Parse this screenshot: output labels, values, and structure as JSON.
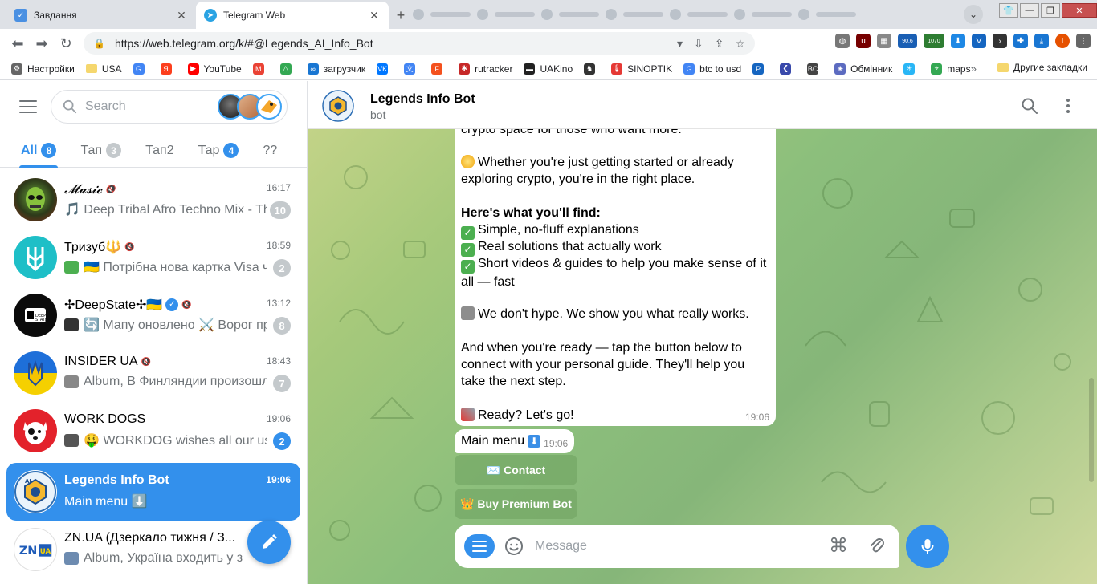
{
  "browser": {
    "tabs": [
      {
        "title": "Завдання"
      },
      {
        "title": "Telegram Web"
      }
    ],
    "url": "https://web.telegram.org/k/#@Legends_AI_Info_Bot",
    "ext_badges": {
      "speed": "90.6",
      "counter": "1070"
    },
    "bookmarks": [
      {
        "label": "Настройки"
      },
      {
        "label": "USA"
      },
      {
        "label": ""
      },
      {
        "label": ""
      },
      {
        "label": "YouTube"
      },
      {
        "label": ""
      },
      {
        "label": ""
      },
      {
        "label": "загрузчик"
      },
      {
        "label": ""
      },
      {
        "label": ""
      },
      {
        "label": ""
      },
      {
        "label": "rutracker"
      },
      {
        "label": "UAKino"
      },
      {
        "label": ""
      },
      {
        "label": "SINOPTIK"
      },
      {
        "label": "btc to usd"
      },
      {
        "label": ""
      },
      {
        "label": ""
      },
      {
        "label": ""
      },
      {
        "label": "Обмінник"
      },
      {
        "label": ""
      },
      {
        "label": "maps"
      }
    ],
    "bookmarks_more": "»",
    "other_bookmarks": "Другие закладки"
  },
  "sidebar": {
    "search_placeholder": "Search",
    "folders": [
      {
        "label": "All",
        "count": "8"
      },
      {
        "label": "Тап",
        "count": "3"
      },
      {
        "label": "Тап2",
        "count": ""
      },
      {
        "label": "Тар",
        "count": "4"
      },
      {
        "label": "??",
        "count": ""
      }
    ],
    "chats": [
      {
        "title": "𝓜𝓾𝓼𝓲𝓬",
        "time": "16:17",
        "preview": "🎵 Deep Tribal Afro Techno Mix - The Journey Begins",
        "badge": "10"
      },
      {
        "title": "Тризуб🔱",
        "time": "18:59",
        "preview": "🇺🇦 Потрібна нова картка Visa чи Mastercard",
        "badge": "2"
      },
      {
        "title": "✢DeepState✢🇺🇦",
        "time": "13:12",
        "preview": "🔄 Мапу оновлено ⚔️ Ворог просунувся",
        "badge": "8"
      },
      {
        "title": "INSIDER UA",
        "time": "18:43",
        "preview": "Album, В Финляндии произошло",
        "badge": "7"
      },
      {
        "title": "WORK DOGS",
        "time": "19:06",
        "preview": "🤑 WORKDOG wishes all our users",
        "badge": "2"
      },
      {
        "title": "Legends Info Bot",
        "time": "19:06",
        "preview": "Main menu ⬇️",
        "badge": ""
      },
      {
        "title": "ZN.UA (Дзеркало тижня / З...",
        "time": "",
        "preview": "Album, Україна входить у з",
        "badge": ""
      }
    ]
  },
  "header": {
    "title": "Legends Info Bot",
    "subtitle": "bot"
  },
  "message": {
    "cut_line": "crypto space for those who want more.",
    "p1": "Whether you're just getting started or already exploring crypto, you're in the right place.",
    "heading": "Here's what you'll find:",
    "items": [
      "Simple, no-fluff explanations",
      "Real solutions that actually work",
      "Short videos & guides to help you make sense of it all — fast"
    ],
    "p2": "We don't hype. We show you what really works.",
    "p3": "And when you're ready — tap the button below to connect with your personal guide. They'll help you take the next step.",
    "p4": "Ready? Let's go!",
    "time": "19:06"
  },
  "menu_message": {
    "text": "Main menu",
    "time": "19:06"
  },
  "keyboard": [
    {
      "label": "✉️ Contact"
    },
    {
      "label": "👑 Buy Premium Bot"
    }
  ],
  "composer": {
    "placeholder": "Message"
  },
  "colors": {
    "accent": "#3390ec",
    "badge_gray": "#c4c9cc"
  }
}
